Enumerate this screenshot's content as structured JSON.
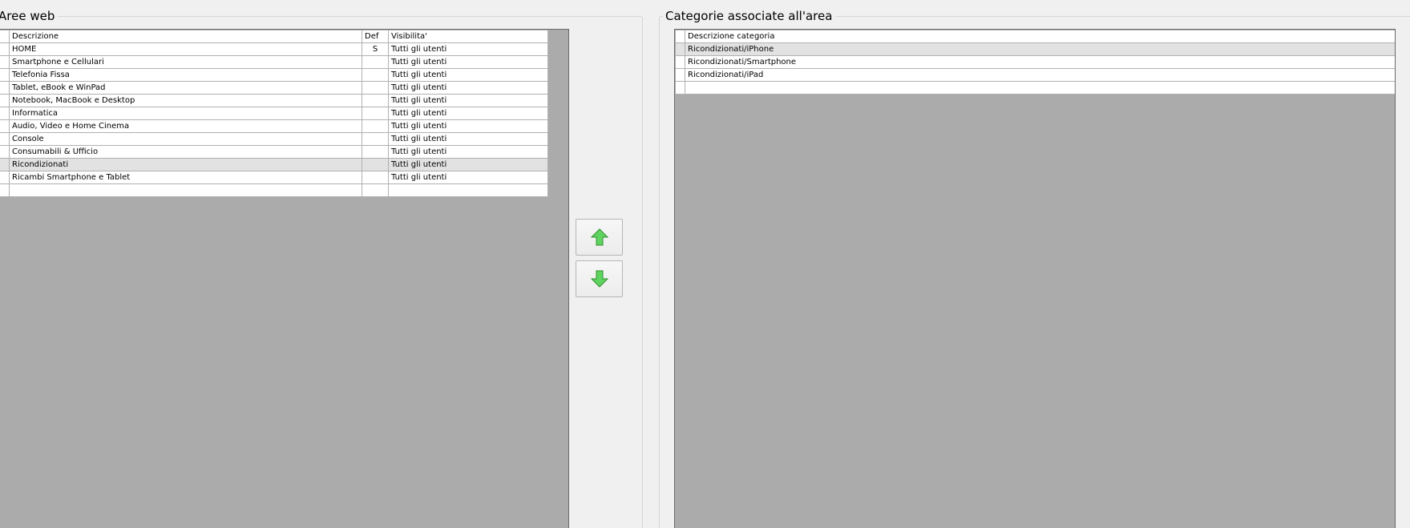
{
  "left_panel": {
    "title": "Aree web",
    "columns": [
      "Descrizione",
      "Def",
      "Visibilita'"
    ],
    "rows": [
      {
        "descrizione": "HOME",
        "def": "S",
        "visibilita": "Tutti gli utenti"
      },
      {
        "descrizione": "Smartphone e Cellulari",
        "def": "",
        "visibilita": "Tutti gli utenti"
      },
      {
        "descrizione": "Telefonia Fissa",
        "def": "",
        "visibilita": "Tutti gli utenti"
      },
      {
        "descrizione": "Tablet, eBook e WinPad",
        "def": "",
        "visibilita": "Tutti gli utenti"
      },
      {
        "descrizione": "Notebook, MacBook e Desktop",
        "def": "",
        "visibilita": "Tutti gli utenti"
      },
      {
        "descrizione": "Informatica",
        "def": "",
        "visibilita": "Tutti gli utenti"
      },
      {
        "descrizione": "Audio, Video e Home Cinema",
        "def": "",
        "visibilita": "Tutti gli utenti"
      },
      {
        "descrizione": "Console",
        "def": "",
        "visibilita": "Tutti gli utenti"
      },
      {
        "descrizione": "Consumabili & Ufficio",
        "def": "",
        "visibilita": "Tutti gli utenti"
      },
      {
        "descrizione": "Ricondizionati",
        "def": "",
        "visibilita": "Tutti gli utenti"
      },
      {
        "descrizione": "Ricambi Smartphone e Tablet",
        "def": "",
        "visibilita": "Tutti gli utenti"
      }
    ],
    "selected_row": 9
  },
  "move_buttons": {
    "up_icon": "green-arrow-up-icon",
    "down_icon": "green-arrow-down-icon",
    "arrow_color": "#5fd35f"
  },
  "right_panel": {
    "title": "Categorie associate all'area",
    "columns": [
      "Descrizione categoria"
    ],
    "rows": [
      {
        "descrizione": "Ricondizionati/iPhone"
      },
      {
        "descrizione": "Ricondizionati/Smartphone"
      },
      {
        "descrizione": "Ricondizionati/iPad"
      }
    ],
    "selected_row": 0
  }
}
